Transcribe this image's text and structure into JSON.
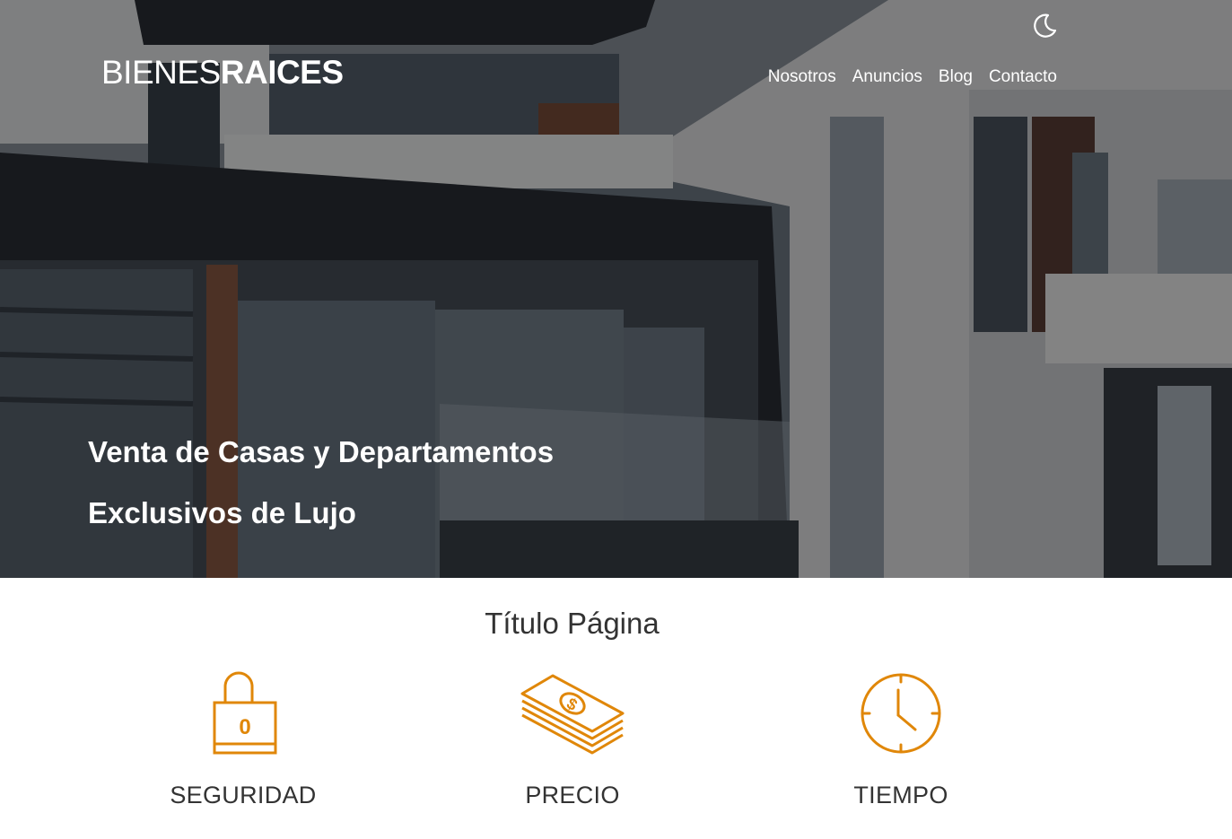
{
  "brand": {
    "part_light": "BIENES",
    "part_bold": "RAICES"
  },
  "header": {
    "dark_mode_icon": "moon-icon",
    "nav": [
      {
        "label": "Nosotros"
      },
      {
        "label": "Anuncios"
      },
      {
        "label": "Blog"
      },
      {
        "label": "Contacto"
      }
    ]
  },
  "hero": {
    "title": "Venta de Casas y Departamentos Exclusivos de Lujo"
  },
  "main": {
    "title": "Título Página",
    "features": [
      {
        "label": "SEGURIDAD",
        "icon": "padlock-icon"
      },
      {
        "label": "PRECIO",
        "icon": "money-stack-icon"
      },
      {
        "label": "TIEMPO",
        "icon": "clock-icon"
      }
    ]
  },
  "colors": {
    "accent": "#E08709",
    "text": "#333333",
    "overlay": "rgba(0,0,0,0.45)"
  }
}
